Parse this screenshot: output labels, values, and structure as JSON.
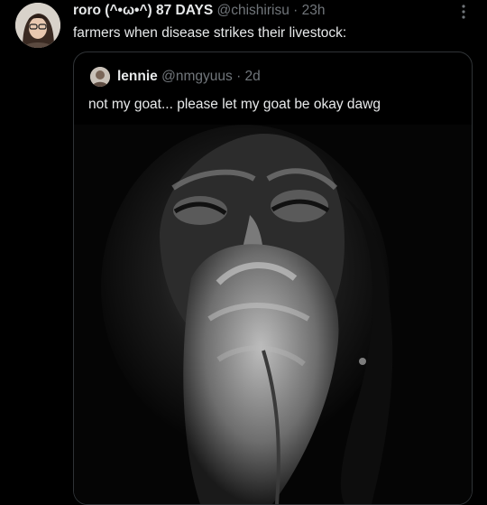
{
  "post": {
    "author_name": "roro (^•ω•^) 87 DAYS",
    "handle": "@chishirisu",
    "separator": "·",
    "time": "23h",
    "text": "farmers when disease strikes their livestock:",
    "avatar_icon": "user-avatar",
    "more_icon": "more-vertical-icon"
  },
  "quote": {
    "author_name": "lennie",
    "handle": "@nmgyuus",
    "separator": "·",
    "time": "2d",
    "text": "not my goat... please let my goat be okay dawg",
    "avatar_icon": "user-avatar"
  },
  "colors": {
    "background": "#000000",
    "text_primary": "#e7e9ea",
    "text_secondary": "#71767b",
    "border": "#2f3336"
  }
}
